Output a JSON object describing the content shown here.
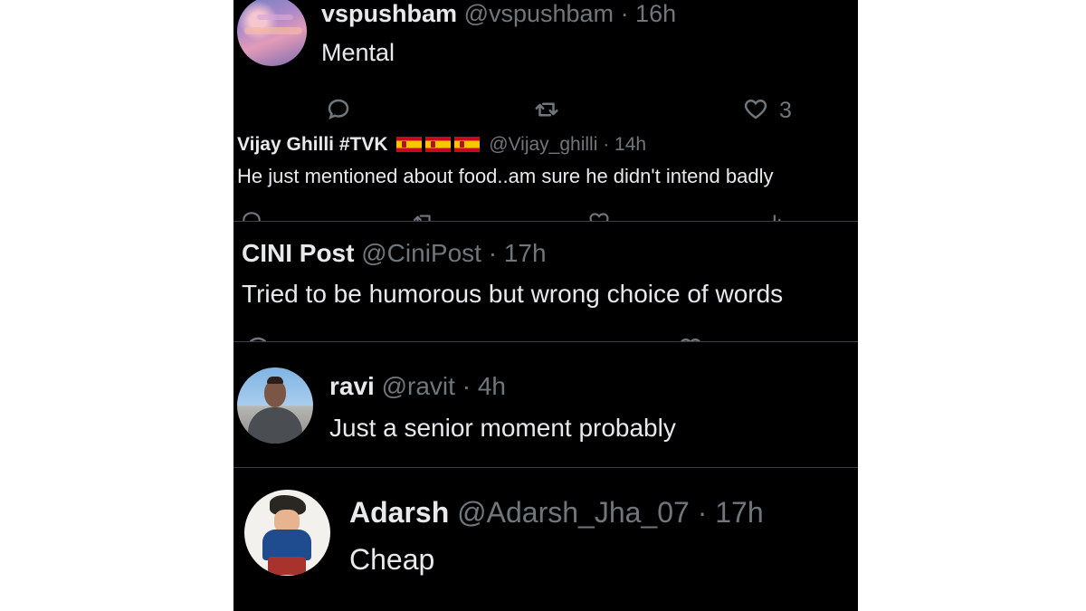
{
  "tweets": [
    {
      "name": "vspushbam",
      "handle": "@vspushbam",
      "time": "· 16h",
      "text": "Mental",
      "like_count": "3"
    },
    {
      "name": "Vijay Ghilli #TVK",
      "handle": "@Vijay_ghilli",
      "time": "· 14h",
      "text": "He just mentioned about food..am sure he didn't intend badly"
    },
    {
      "name": "CINI Post",
      "handle": "@CiniPost",
      "time": "· 17h",
      "text": "Tried to be humorous but wrong choice of words"
    },
    {
      "name": "ravi",
      "handle": "@ravit",
      "time": "· 4h",
      "text": "Just a senior moment probably"
    },
    {
      "name": "Adarsh",
      "handle": "@Adarsh_Jha_07",
      "time": "· 17h",
      "text": "Cheap"
    }
  ],
  "icons": {
    "reply": "reply-icon",
    "retweet": "retweet-icon",
    "like": "heart-icon",
    "flag": "spain-flag-icon"
  },
  "colors": {
    "background": "#000000",
    "primary_text": "#e7e9ea",
    "secondary_text": "#71767b",
    "divider": "#3a3d42"
  }
}
